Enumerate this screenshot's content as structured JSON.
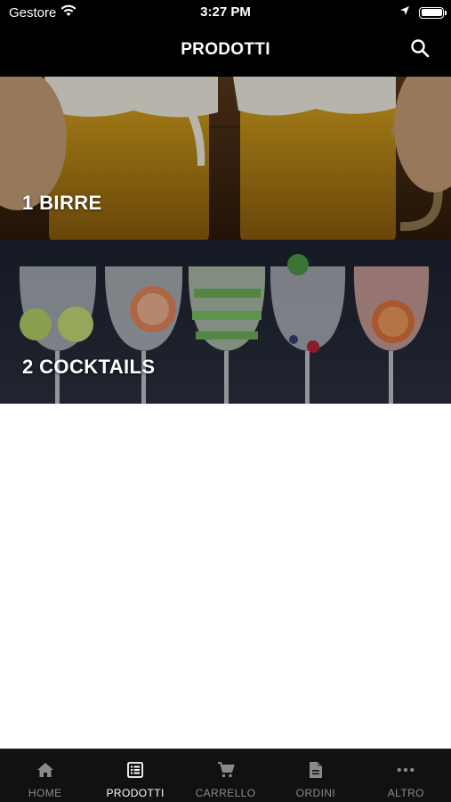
{
  "status_bar": {
    "carrier": "Gestore",
    "time": "3:27 PM"
  },
  "nav": {
    "title": "PRODOTTI",
    "search_icon": "search-icon"
  },
  "categories": [
    {
      "label": "1 BIRRE",
      "image": "beer-mugs-photo"
    },
    {
      "label": "2 COCKTAILS",
      "image": "cocktail-glasses-photo"
    }
  ],
  "tabs": [
    {
      "label": "HOME",
      "icon": "home-icon",
      "active": false
    },
    {
      "label": "PRODOTTI",
      "icon": "list-icon",
      "active": true
    },
    {
      "label": "CARRELLO",
      "icon": "cart-icon",
      "active": false
    },
    {
      "label": "ORDINI",
      "icon": "document-icon",
      "active": false
    },
    {
      "label": "ALTRO",
      "icon": "more-icon",
      "active": false
    }
  ],
  "colors": {
    "bar_background": "#000000",
    "tabbar_background": "#111111",
    "tab_inactive": "#8a8a8a",
    "tab_active": "#ffffff"
  }
}
